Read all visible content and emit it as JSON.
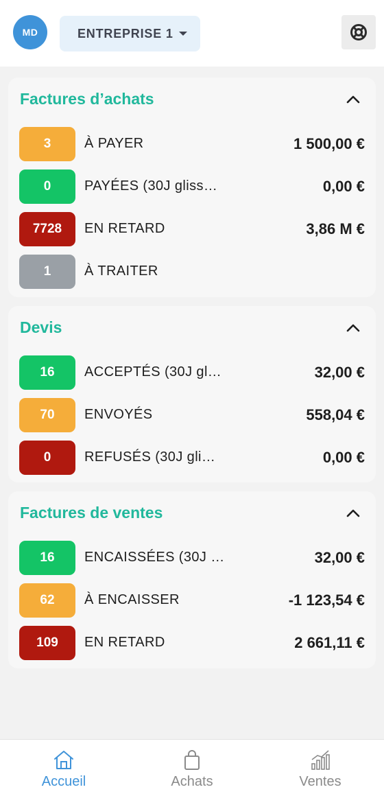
{
  "header": {
    "avatar_initials": "MD",
    "company_label": "ENTREPRISE 1",
    "company_icon": "chevron-down-icon",
    "help_icon": "lifebuoy-icon"
  },
  "colors": {
    "accent": "#21b89c",
    "brand_blue": "#3f93d9",
    "orange": "#f5ad3a",
    "green": "#14c466",
    "red": "#b0190f",
    "grey": "#9aa0a6"
  },
  "sections": [
    {
      "title": "Factures d’achats",
      "rows": [
        {
          "count": "3",
          "label": "À PAYER",
          "amount": "1 500,00 €"
        },
        {
          "count": "0",
          "label": "PAYÉES (30J gliss…",
          "amount": "0,00 €"
        },
        {
          "count": "7728",
          "label": "EN RETARD",
          "amount": "3,86 M €"
        },
        {
          "count": "1",
          "label": "À TRAITER",
          "amount": ""
        }
      ]
    },
    {
      "title": "Devis",
      "rows": [
        {
          "count": "16",
          "label": "ACCEPTÉS (30J gl…",
          "amount": "32,00 €"
        },
        {
          "count": "70",
          "label": "ENVOYÉS",
          "amount": "558,04 €"
        },
        {
          "count": "0",
          "label": "REFUSÉS (30J gli…",
          "amount": "0,00 €"
        }
      ]
    },
    {
      "title": "Factures de ventes",
      "rows": [
        {
          "count": "16",
          "label": "ENCAISSÉES (30J …",
          "amount": "32,00 €"
        },
        {
          "count": "62",
          "label": "À ENCAISSER",
          "amount": "-1 123,54 €"
        },
        {
          "count": "109",
          "label": "EN RETARD",
          "amount": "2 661,11 €"
        }
      ]
    }
  ],
  "nav": [
    {
      "label": "Accueil",
      "icon": "home-icon",
      "active": true
    },
    {
      "label": "Achats",
      "icon": "shopping-bag-icon",
      "active": false
    },
    {
      "label": "Ventes",
      "icon": "bar-chart-icon",
      "active": false
    }
  ]
}
